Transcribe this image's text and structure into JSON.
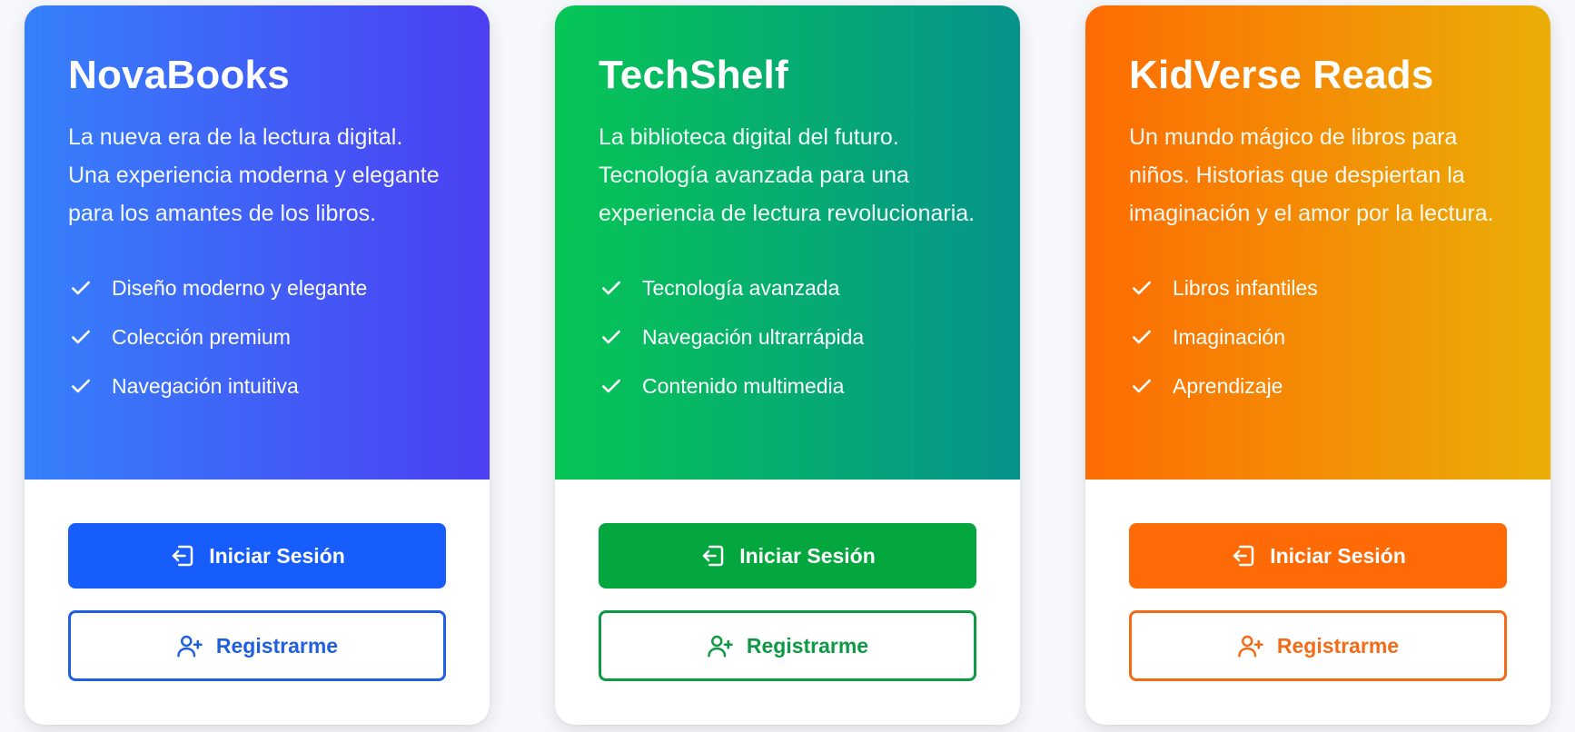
{
  "cards": [
    {
      "title": "NovaBooks",
      "description": "La nueva era de la lectura digital. Una experiencia moderna y elegante para los amantes de los libros.",
      "features": [
        "Diseño moderno y elegante",
        "Colección premium",
        "Navegación intuitiva"
      ],
      "login_label": "Iniciar Sesión",
      "register_label": "Registrarme",
      "colors": {
        "gradient_start": "#3681fb",
        "gradient_end": "#4b3ff2",
        "accent": "#175dfb"
      },
      "icons": {
        "feature": "check-icon",
        "login": "login-icon",
        "register": "user-plus-icon"
      }
    },
    {
      "title": "TechShelf",
      "description": "La biblioteca digital del futuro. Tecnología avanzada para una experiencia de lectura revolucionaria.",
      "features": [
        "Tecnología avanzada",
        "Navegación ultrarrápida",
        "Contenido multimedia"
      ],
      "login_label": "Iniciar Sesión",
      "register_label": "Registrarme",
      "colors": {
        "gradient_start": "#06c654",
        "gradient_end": "#06938c",
        "accent": "#04a63e"
      },
      "icons": {
        "feature": "check-icon",
        "login": "login-icon",
        "register": "user-plus-icon"
      }
    },
    {
      "title": "KidVerse Reads",
      "description": "Un mundo mágico de libros para niños. Historias que despiertan la imaginación y el amor por la lectura.",
      "features": [
        "Libros infantiles",
        "Imaginación",
        "Aprendizaje"
      ],
      "login_label": "Iniciar Sesión",
      "register_label": "Registrarme",
      "colors": {
        "gradient_start": "#fd6c03",
        "gradient_end": "#eaae06",
        "accent": "#fe6a06"
      },
      "icons": {
        "feature": "check-icon",
        "login": "login-icon",
        "register": "user-plus-icon"
      }
    }
  ]
}
